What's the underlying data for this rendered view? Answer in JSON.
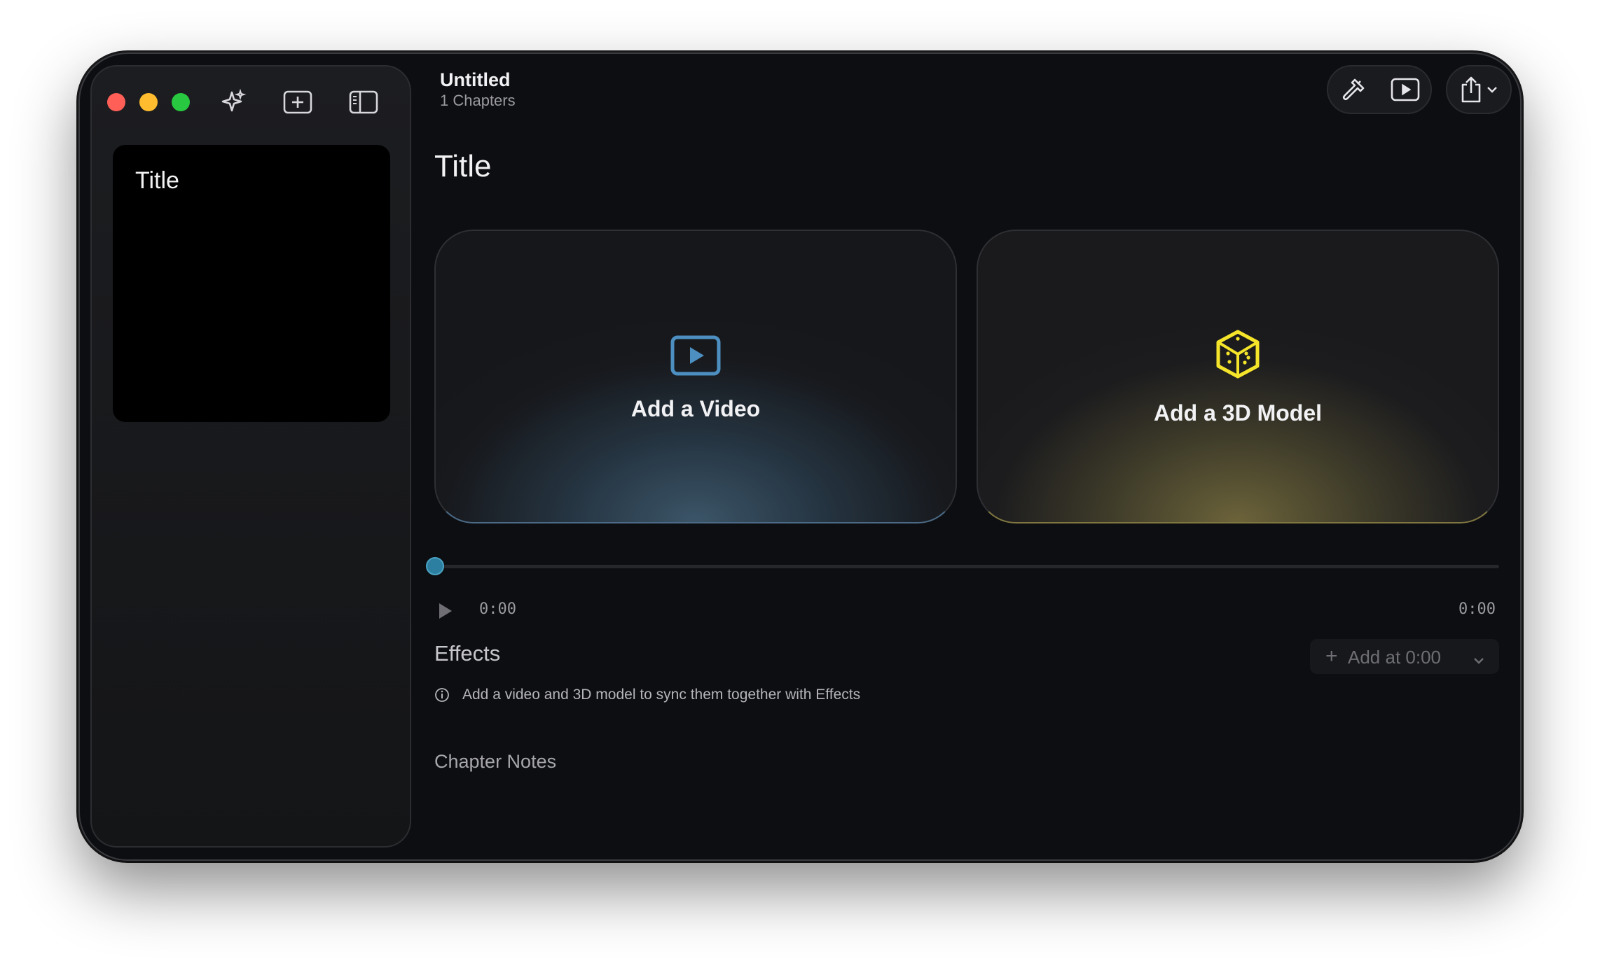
{
  "window": {
    "traffic_lights": {
      "close_color": "#ff5f57",
      "minimize_color": "#febc2e",
      "maximize_color": "#28c840"
    }
  },
  "sidebar": {
    "toolbar_icons": [
      "sparkles-icon",
      "add-chapter-icon",
      "sidebar-toggle-icon"
    ],
    "chapters": [
      {
        "title": "Title"
      }
    ]
  },
  "header": {
    "title": "Untitled",
    "subtitle": "1 Chapters",
    "actions": [
      "hammer-icon",
      "play-preview-icon",
      "share-icon",
      "chevron-down-icon"
    ]
  },
  "main": {
    "chapter_title": "Title",
    "cards": {
      "video": {
        "label": "Add a Video",
        "icon": "video-play-icon",
        "accent": "#4c8fc0"
      },
      "model": {
        "label": "Add a 3D Model",
        "icon": "cube-icon",
        "accent": "#f5e52a"
      }
    },
    "player": {
      "progress": 0,
      "current_time": "0:00",
      "duration": "0:00",
      "thumb_color": "#2c7fa1"
    },
    "effects": {
      "title": "Effects",
      "add_button_label": "Add at 0:00",
      "info_text": "Add a video and 3D model to sync them together with Effects"
    },
    "notes": {
      "title": "Chapter Notes"
    }
  }
}
